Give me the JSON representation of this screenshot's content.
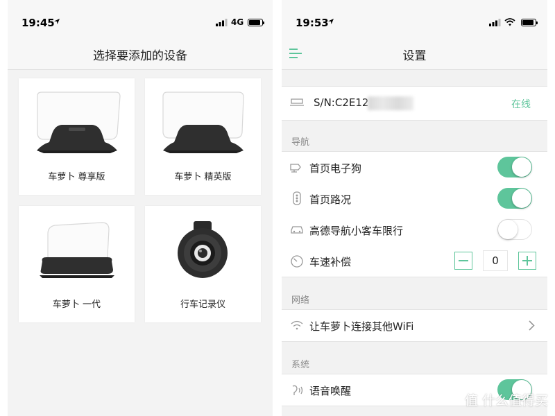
{
  "left": {
    "status": {
      "time": "19:45",
      "network": "4G"
    },
    "title": "选择要添加的设备",
    "devices": [
      {
        "label": "车萝卜 尊享版",
        "icon": "hud-device-icon"
      },
      {
        "label": "车萝卜 精英版",
        "icon": "hud-device-icon"
      },
      {
        "label": "车萝卜 一代",
        "icon": "hud-device-icon"
      },
      {
        "label": "行车记录仪",
        "icon": "dashcam-icon"
      }
    ]
  },
  "right": {
    "status": {
      "time": "19:53"
    },
    "title": "设置",
    "device": {
      "serial": "S/N:C2E12",
      "status": "在线"
    },
    "sections": {
      "nav": "导航",
      "network": "网络",
      "system": "系统"
    },
    "items": {
      "dog": {
        "label": "首页电子狗",
        "on": true
      },
      "traffic": {
        "label": "首页路况",
        "on": true
      },
      "limit": {
        "label": "高德导航小客车限行",
        "on": false
      },
      "speed": {
        "label": "车速补偿",
        "value": "0"
      },
      "wifi": {
        "label": "让车萝卜连接其他WiFi"
      },
      "voice": {
        "label": "语音唤醒",
        "on": true
      }
    }
  },
  "watermark": "值 什么值得买",
  "colors": {
    "accent": "#5ec59b",
    "section_text": "#888888"
  }
}
